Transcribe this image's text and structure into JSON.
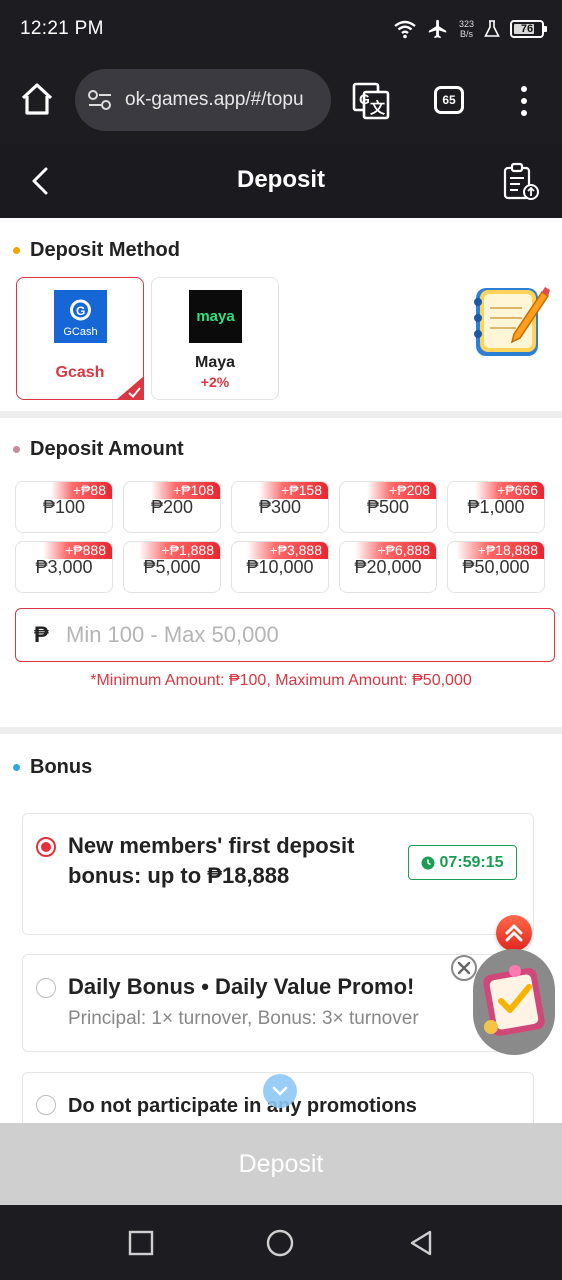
{
  "status": {
    "time": "12:21 PM",
    "net_speed": "323",
    "net_unit": "B/s",
    "battery": "76"
  },
  "browser": {
    "url": "ok-games.app/#/topu",
    "tab_count": "65"
  },
  "header": {
    "title": "Deposit"
  },
  "method_section": {
    "title": "Deposit Method",
    "methods": [
      {
        "name": "Gcash",
        "logo_text": "GCash",
        "extra": "",
        "selected": true
      },
      {
        "name": "Maya",
        "logo_text": "maya",
        "extra": "+2%",
        "selected": false
      }
    ]
  },
  "amount_section": {
    "title": "Deposit Amount",
    "options": [
      {
        "bonus": "+₱88",
        "value": "₱100"
      },
      {
        "bonus": "+₱108",
        "value": "₱200"
      },
      {
        "bonus": "+₱158",
        "value": "₱300"
      },
      {
        "bonus": "+₱208",
        "value": "₱500"
      },
      {
        "bonus": "+₱666",
        "value": "₱1,000"
      },
      {
        "bonus": "+₱888",
        "value": "₱3,000"
      },
      {
        "bonus": "+₱1,888",
        "value": "₱5,000"
      },
      {
        "bonus": "+₱3,888",
        "value": "₱10,000"
      },
      {
        "bonus": "+₱6,888",
        "value": "₱20,000"
      },
      {
        "bonus": "+₱18,888",
        "value": "₱50,000"
      }
    ],
    "currency": "₱",
    "input_placeholder": "Min 100 - Max 50,000",
    "input_value": "",
    "hint": "*Minimum Amount: ₱100, Maximum Amount: ₱50,000"
  },
  "bonus_section": {
    "title": "Bonus",
    "options": [
      {
        "title_line1": "New members' first deposit",
        "title_line2": "bonus: up to ₱18,888",
        "timer": "07:59:15",
        "selected": true
      },
      {
        "title_line1": "Daily Bonus • Daily Value Promo!",
        "subtitle": "Principal: 1× turnover, Bonus: 3× turnover",
        "selected": false
      },
      {
        "title_line1": "Do not participate in any promotions",
        "selected": false
      }
    ]
  },
  "submit": {
    "label": "Deposit"
  },
  "colors": {
    "accent": "#d93742",
    "timer_green": "#1a9e53",
    "dark_bg": "#1b1b1f",
    "disabled_button": "#cfcfcf"
  }
}
